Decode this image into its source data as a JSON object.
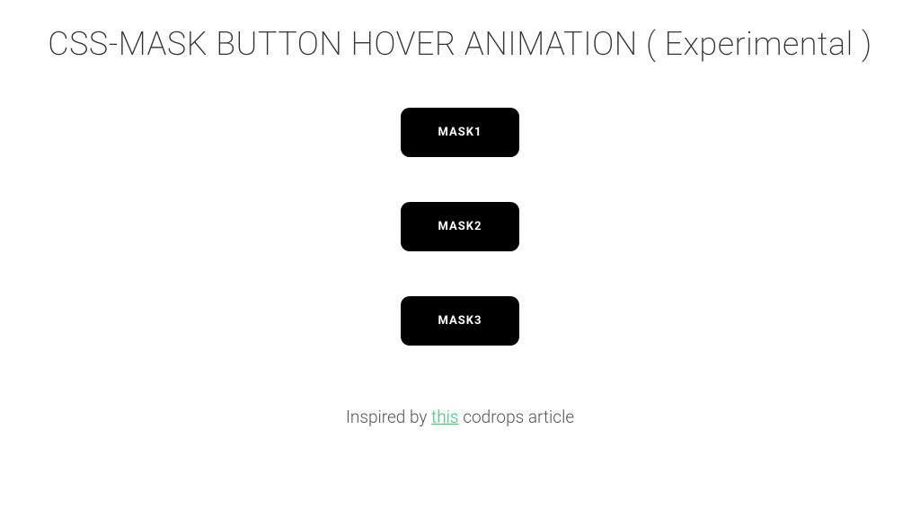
{
  "title": "CSS-MASK BUTTON HOVER ANIMATION ( Experimental )",
  "buttons": [
    {
      "label": "MASK1"
    },
    {
      "label": "MASK2"
    },
    {
      "label": "MASK3"
    }
  ],
  "footer": {
    "prefix": "Inspired by ",
    "link_text": "this",
    "suffix": " codrops article"
  },
  "colors": {
    "accent": "#2ecc71",
    "button_bg": "#000000",
    "button_text": "#ffffff"
  }
}
